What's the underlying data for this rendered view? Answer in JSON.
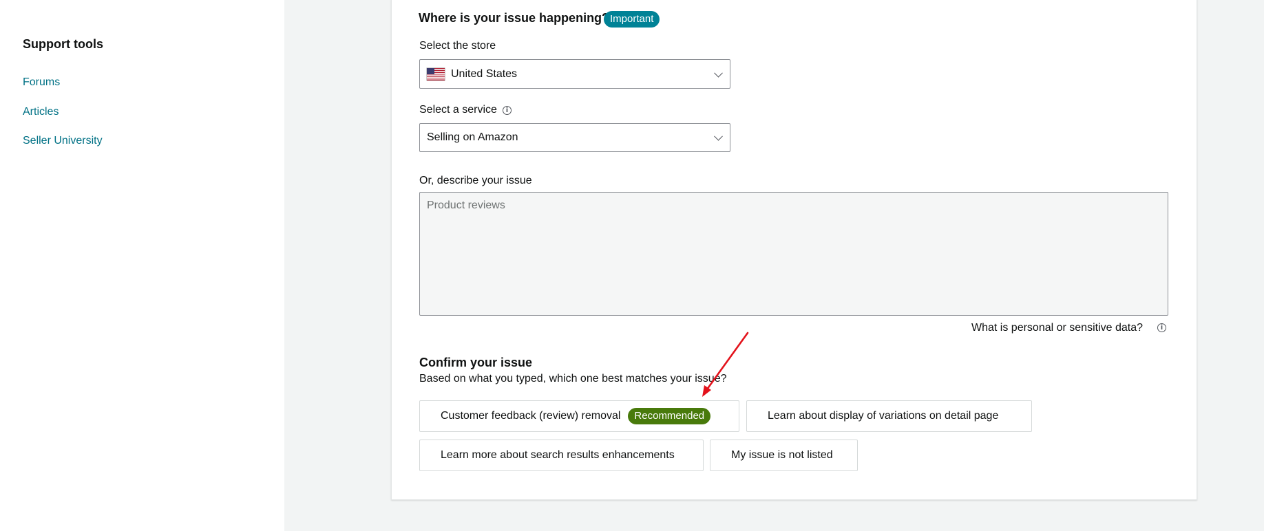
{
  "sidebar": {
    "title": "Support tools",
    "links": [
      {
        "label": "Forums"
      },
      {
        "label": "Articles"
      },
      {
        "label": "Seller University"
      }
    ]
  },
  "form": {
    "heading": "Where is your issue happening?",
    "important_badge": "Important",
    "store": {
      "label": "Select the store",
      "value": "United States",
      "flag_icon": "us-flag-icon"
    },
    "service": {
      "label": "Select a service",
      "value": "Selling on Amazon",
      "info_icon": "info-icon"
    },
    "describe": {
      "label": "Or, describe your issue",
      "placeholder": "Product reviews"
    },
    "sensitive_link": "What is personal or sensitive data?"
  },
  "confirm": {
    "title": "Confirm your issue",
    "subtitle": "Based on what you typed, which one best matches your issue?",
    "options": [
      {
        "label": "Customer feedback (review) removal",
        "badge": "Recommended"
      },
      {
        "label": "Learn about display of variations on detail page"
      },
      {
        "label": "Learn more about search results enhancements"
      },
      {
        "label": "My issue is not listed"
      }
    ]
  },
  "colors": {
    "link": "#007185",
    "important_badge": "#008296",
    "recommended_badge": "#487a0b",
    "annotation_arrow": "#e3121b"
  }
}
